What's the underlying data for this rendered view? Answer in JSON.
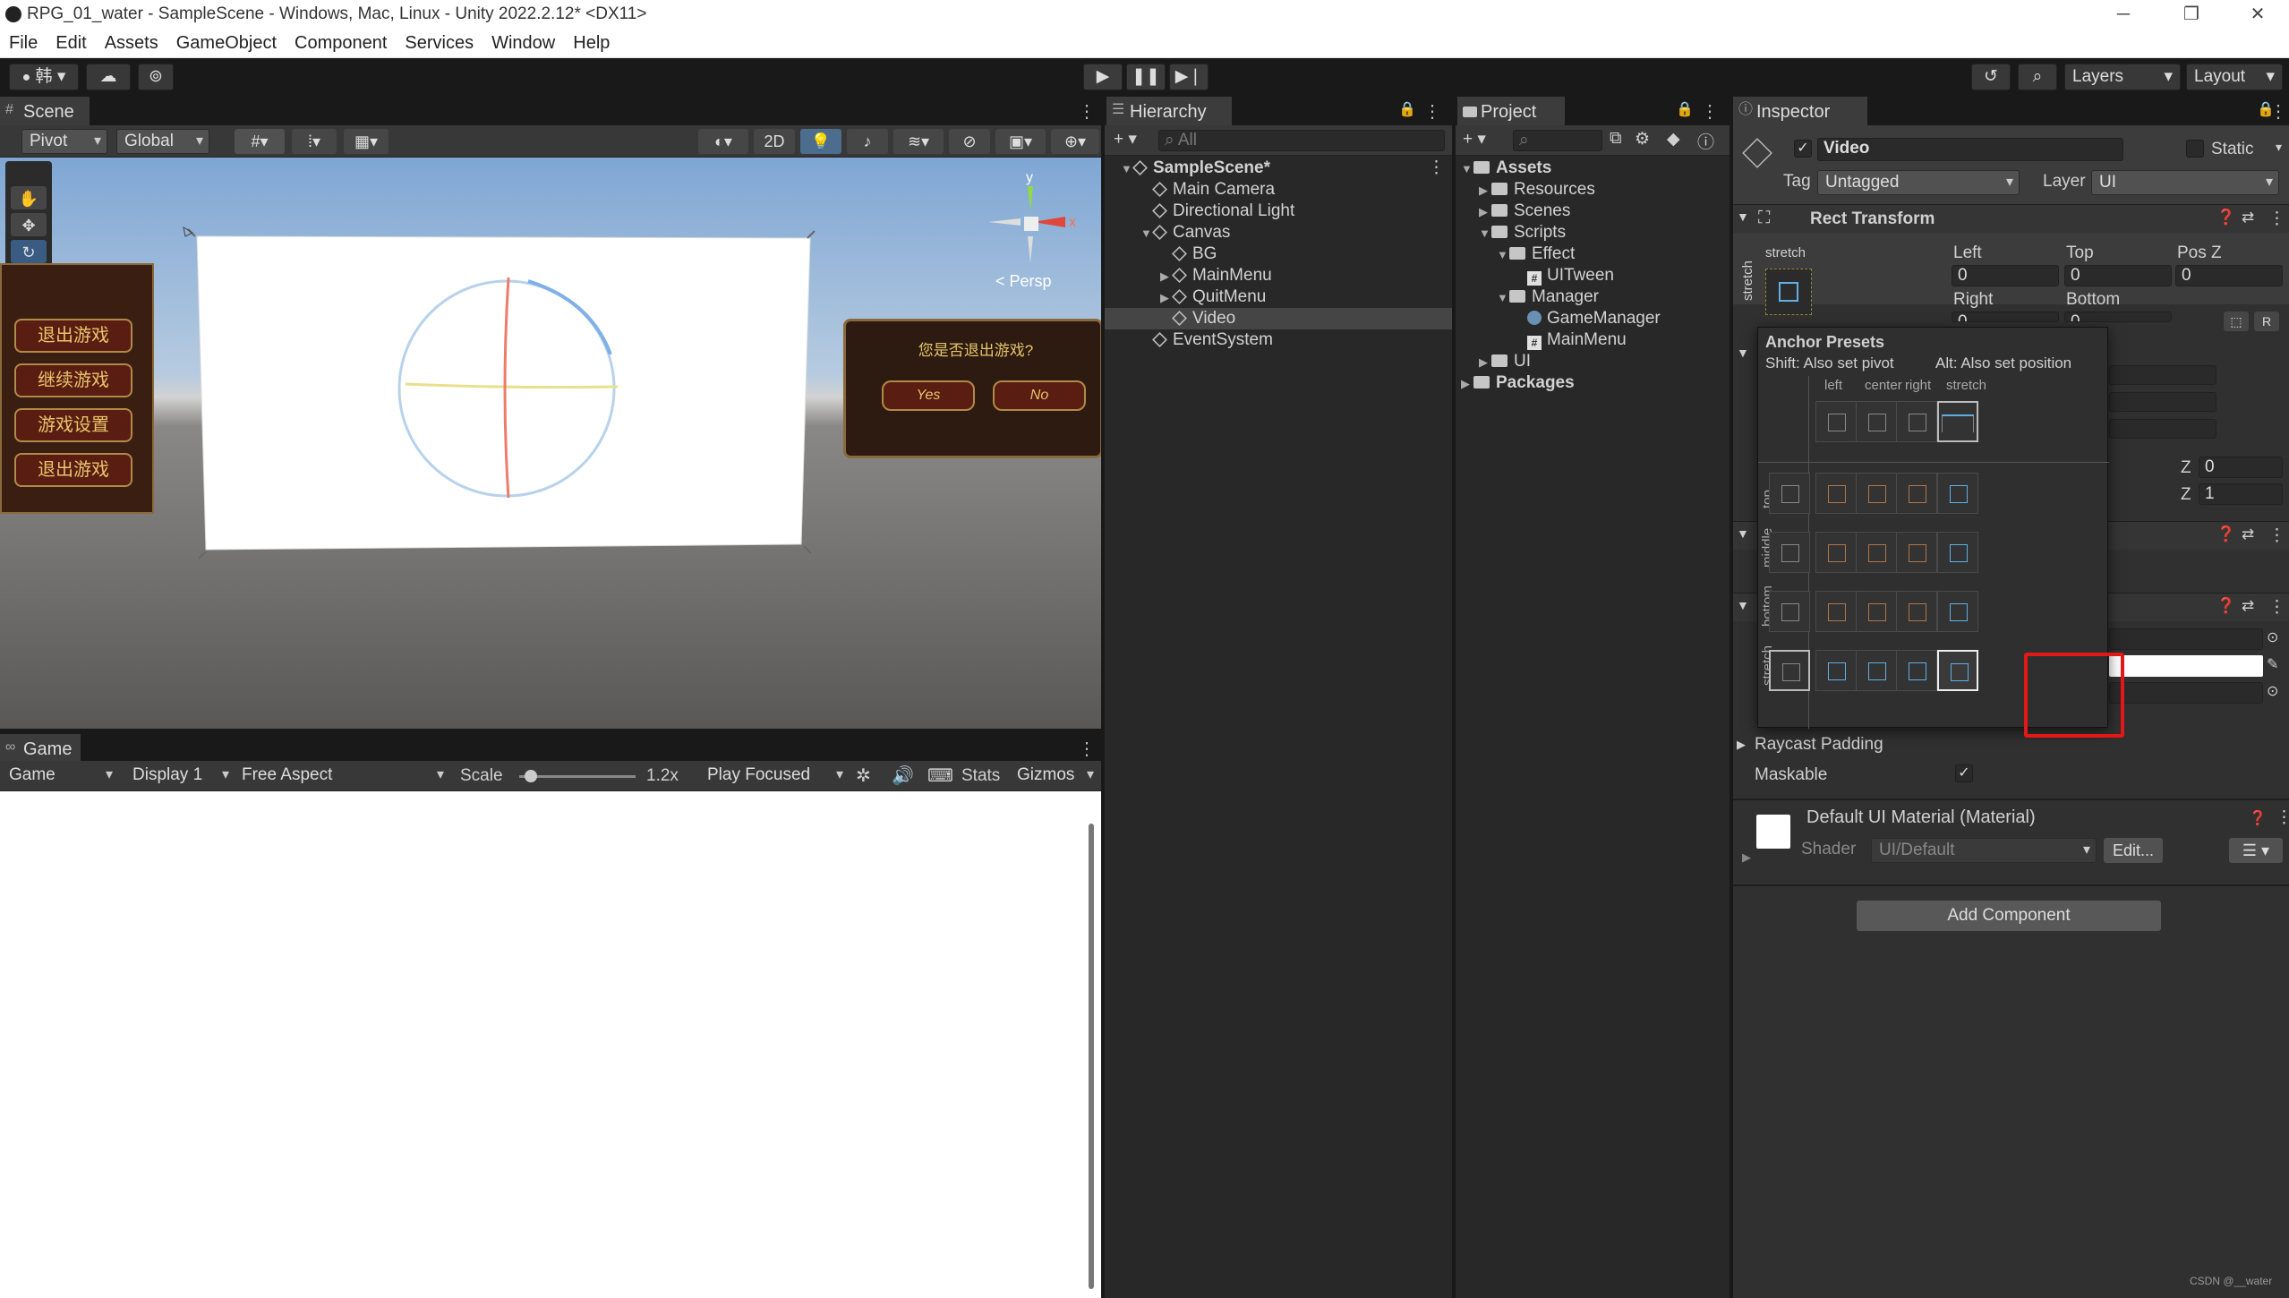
{
  "window": {
    "title": "RPG_01_water - SampleScene - Windows, Mac, Linux - Unity 2022.2.12* <DX11>"
  },
  "menu": [
    "File",
    "Edit",
    "Assets",
    "GameObject",
    "Component",
    "Services",
    "Window",
    "Help"
  ],
  "toolbar": {
    "account": "韩",
    "layers": "Layers",
    "layout": "Layout"
  },
  "scene": {
    "tab": "Scene",
    "pivot": "Pivot",
    "global": "Global",
    "mode2d": "2D",
    "persp": "< Persp",
    "gizmo_y": "y",
    "gizmo_x": "x",
    "menu_buttons": [
      "退出游戏",
      "继续游戏",
      "游戏设置",
      "退出游戏"
    ],
    "dialog": {
      "question": "您是否退出游戏?",
      "yes": "Yes",
      "no": "No"
    }
  },
  "game": {
    "tab": "Game",
    "mode": "Game",
    "display": "Display 1",
    "aspect": "Free Aspect",
    "scale_label": "Scale",
    "scale_value": "1.2x",
    "scale_fraction": 0.05,
    "play_focused": "Play Focused",
    "stats": "Stats",
    "gizmos": "Gizmos"
  },
  "hierarchy": {
    "tab": "Hierarchy",
    "search_placeholder": "All",
    "items": [
      {
        "label": "SampleScene*",
        "depth": 0,
        "kind": "scene",
        "expanded": true
      },
      {
        "label": "Main Camera",
        "depth": 1,
        "kind": "object"
      },
      {
        "label": "Directional Light",
        "depth": 1,
        "kind": "object"
      },
      {
        "label": "Canvas",
        "depth": 1,
        "kind": "object",
        "expanded": true
      },
      {
        "label": "BG",
        "depth": 2,
        "kind": "object"
      },
      {
        "label": "MainMenu",
        "depth": 2,
        "kind": "object",
        "collapsed": true
      },
      {
        "label": "QuitMenu",
        "depth": 2,
        "kind": "object",
        "collapsed": true
      },
      {
        "label": "Video",
        "depth": 2,
        "kind": "object",
        "selected": true
      },
      {
        "label": "EventSystem",
        "depth": 1,
        "kind": "object"
      }
    ]
  },
  "project": {
    "tab": "Project",
    "items": [
      {
        "label": "Assets",
        "depth": 0,
        "kind": "folder",
        "expanded": true,
        "bold": true
      },
      {
        "label": "Resources",
        "depth": 1,
        "kind": "folder",
        "collapsed": true
      },
      {
        "label": "Scenes",
        "depth": 1,
        "kind": "folder",
        "collapsed": true
      },
      {
        "label": "Scripts",
        "depth": 1,
        "kind": "folder",
        "expanded": true
      },
      {
        "label": "Effect",
        "depth": 2,
        "kind": "folder",
        "expanded": true
      },
      {
        "label": "UITween",
        "depth": 3,
        "kind": "script"
      },
      {
        "label": "Manager",
        "depth": 2,
        "kind": "folder",
        "expanded": true
      },
      {
        "label": "GameManager",
        "depth": 3,
        "kind": "gear"
      },
      {
        "label": "MainMenu",
        "depth": 3,
        "kind": "script"
      },
      {
        "label": "UI",
        "depth": 1,
        "kind": "folder",
        "collapsed": true
      },
      {
        "label": "Packages",
        "depth": 0,
        "kind": "folder",
        "collapsed": true,
        "bold": true
      }
    ]
  },
  "inspector": {
    "tab": "Inspector",
    "object_name": "Video",
    "static_label": "Static",
    "tag_label": "Tag",
    "tag_value": "Untagged",
    "layer_label": "Layer",
    "layer_value": "UI",
    "rect_transform": "Rect Transform",
    "stretch": "stretch",
    "fields": {
      "left_label": "Left",
      "left": "0",
      "top_label": "Top",
      "top": "0",
      "posz_label": "Pos Z",
      "posz": "0",
      "right_label": "Right",
      "right": "0",
      "bottom_label": "Bottom",
      "bottom": "0",
      "z1_label": "Z",
      "z1": "0",
      "z2_label": "Z",
      "z2": "1"
    },
    "raycast_padding": "Raycast Padding",
    "maskable": "Maskable",
    "material": "Default UI Material (Material)",
    "shader_label": "Shader",
    "shader_value": "UI/Default",
    "edit_button": "Edit...",
    "add_component": "Add Component",
    "r_button": "R"
  },
  "anchor_presets": {
    "title": "Anchor Presets",
    "hint_pivot": "Shift: Also set pivot",
    "hint_position": "Alt: Also set position",
    "columns": [
      "left",
      "center",
      "right",
      "stretch"
    ],
    "rows": [
      "top",
      "middle",
      "bottom",
      "stretch"
    ]
  },
  "watermark": "CSDN @__water"
}
